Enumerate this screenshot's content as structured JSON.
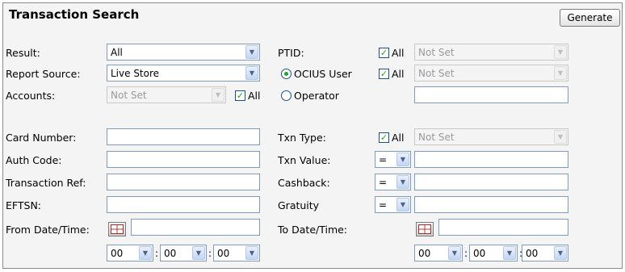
{
  "title": "Transaction Search",
  "generate_label": "Generate",
  "left": {
    "result_label": "Result:",
    "result_value": "All",
    "report_source_label": "Report Source:",
    "report_source_value": "Live Store",
    "accounts_label": "Accounts:",
    "accounts_value": "Not Set",
    "accounts_all_label": "All",
    "card_number_label": "Card Number:",
    "auth_code_label": "Auth Code:",
    "transaction_ref_label": "Transaction Ref:",
    "eftsn_label": "EFTSN:",
    "from_label": "From Date/Time:",
    "from_hour": "00",
    "from_min": "00",
    "from_sec": "00"
  },
  "right": {
    "ptid_label": "PTID:",
    "ptid_all_label": "All",
    "ptid_value": "Not Set",
    "ocius_user_label": "OCIUS User",
    "ocius_all_label": "All",
    "ocius_value": "Not Set",
    "operator_label": "Operator",
    "txn_type_label": "Txn Type:",
    "txn_type_all_label": "All",
    "txn_type_value": "Not Set",
    "txn_value_label": "Txn Value:",
    "txn_value_op": "=",
    "cashback_label": "Cashback:",
    "cashback_op": "=",
    "gratuity_label": "Gratuity",
    "gratuity_op": "=",
    "to_label": "To Date/Time:",
    "to_hour": "00",
    "to_min": "00",
    "to_sec": "00"
  },
  "icons": {
    "dropdown": "chevron-down-icon",
    "calendar": "calendar-icon",
    "checkmark": "checkmark-icon"
  },
  "state": {
    "ptid_all_checked": true,
    "ocius_all_checked": true,
    "accounts_all_checked": true,
    "txn_type_all_checked": true,
    "ocius_user_selected": true,
    "operator_selected": false
  }
}
